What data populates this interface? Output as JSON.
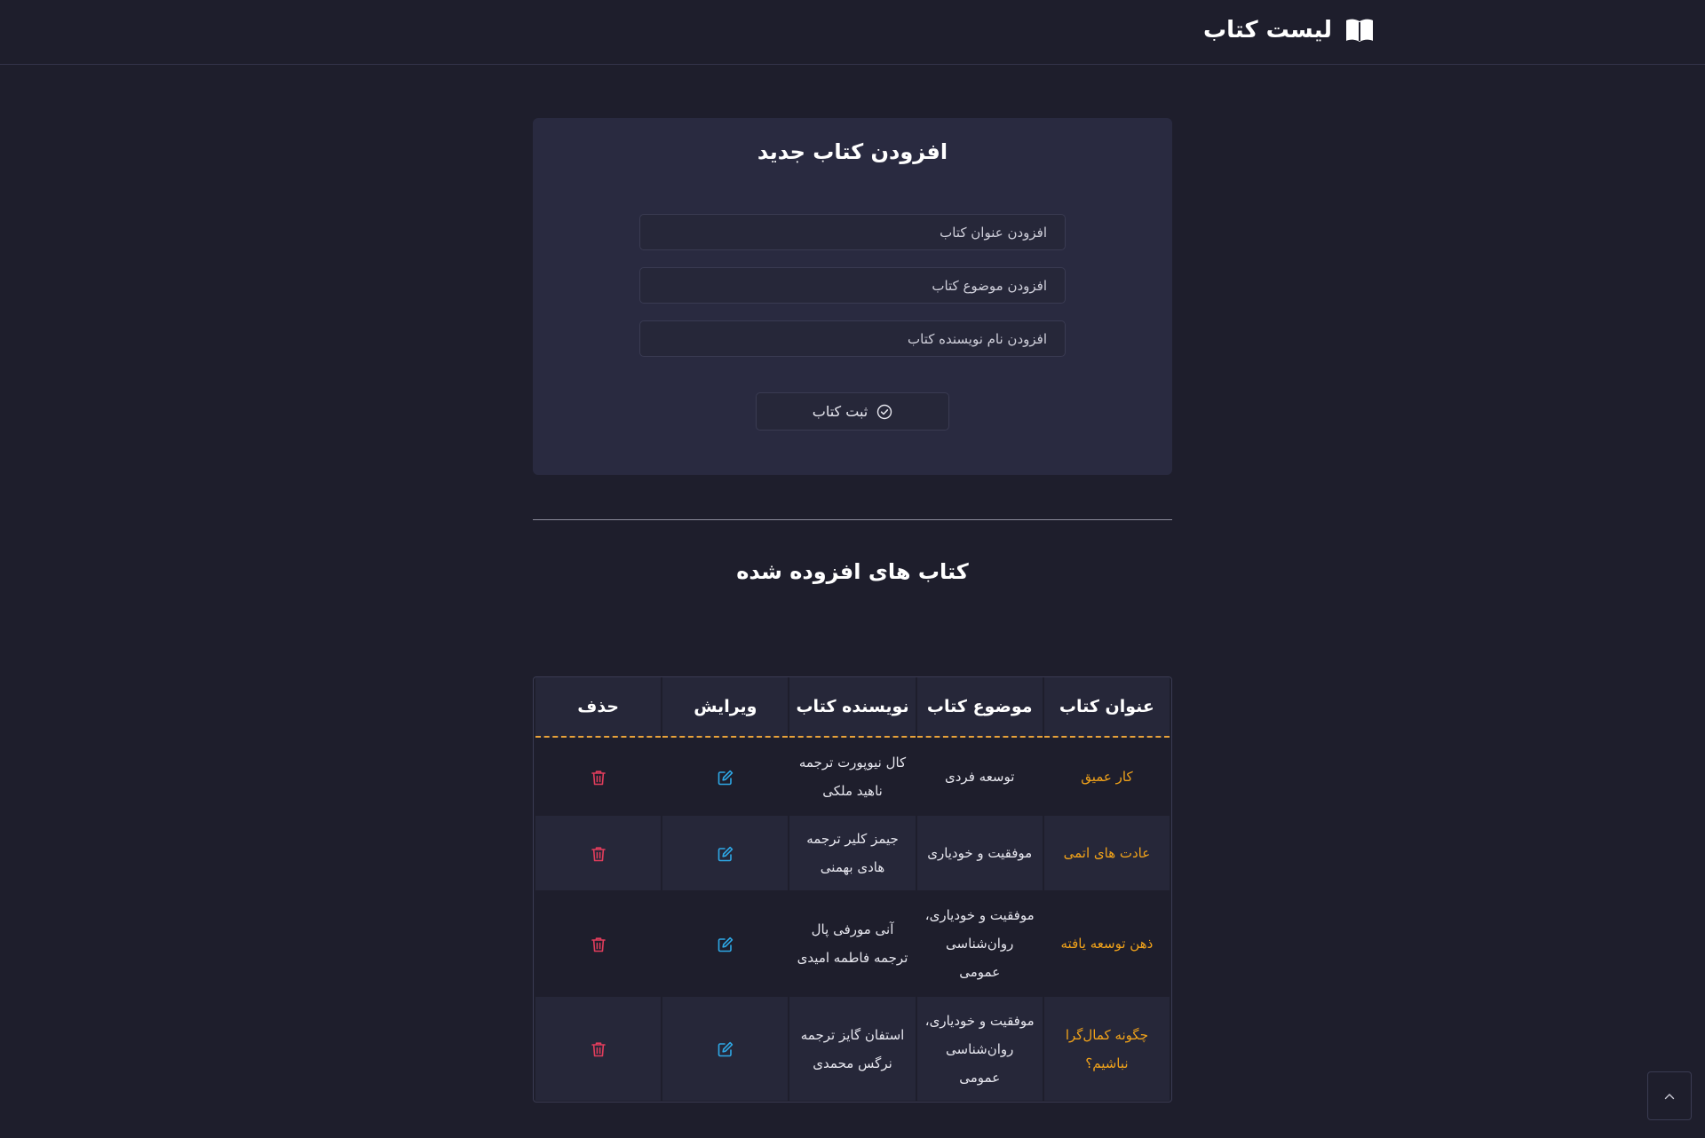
{
  "header": {
    "title": "لیست کتاب",
    "icon": "open-book-icon"
  },
  "form": {
    "title": "افزودن کتاب جدید",
    "title_placeholder": "افزودن عنوان کتاب",
    "subject_placeholder": "افزودن موضوع کتاب",
    "author_placeholder": "افزودن نام نویسنده کتاب",
    "submit_label": "ثبت کتاب",
    "submit_icon": "check-circle-icon"
  },
  "books_section": {
    "title": "کتاب های افزوده شده"
  },
  "table": {
    "headers": [
      "عنوان کتاب",
      "موضوع کتاب",
      "نویسنده کتاب",
      "ویرایش",
      "حذف"
    ],
    "rows": [
      {
        "title": "کار عمیق",
        "subject": "توسعه فردی",
        "author": "کال نیوپورت ترجمه ناهید ملکی"
      },
      {
        "title": "عادت های اتمی",
        "subject": "موفقیت و خودیاری",
        "author": "جیمز کلیر ترجمه هادی بهمنی"
      },
      {
        "title": "ذهن توسعه یافته",
        "subject": "موفقیت و خودیاری، روان‌شناسی عمومی",
        "author": "آنی مورفی پال ترجمه فاطمه امیدی"
      },
      {
        "title": "چگونه کمال‌گرا نباشیم؟",
        "subject": "موفقیت و خودیاری، روان‌شناسی عمومی",
        "author": "استفان گایز ترجمه نرگس محمدی"
      }
    ],
    "edit_icon": "edit-icon",
    "delete_icon": "trash-icon"
  },
  "colors": {
    "background": "#1e1e2c",
    "card": "#292a40",
    "accent_title": "#f0a21a",
    "header_underline": "#e8a23a",
    "edit": "#2ea8e6",
    "delete": "#e23d5c"
  }
}
